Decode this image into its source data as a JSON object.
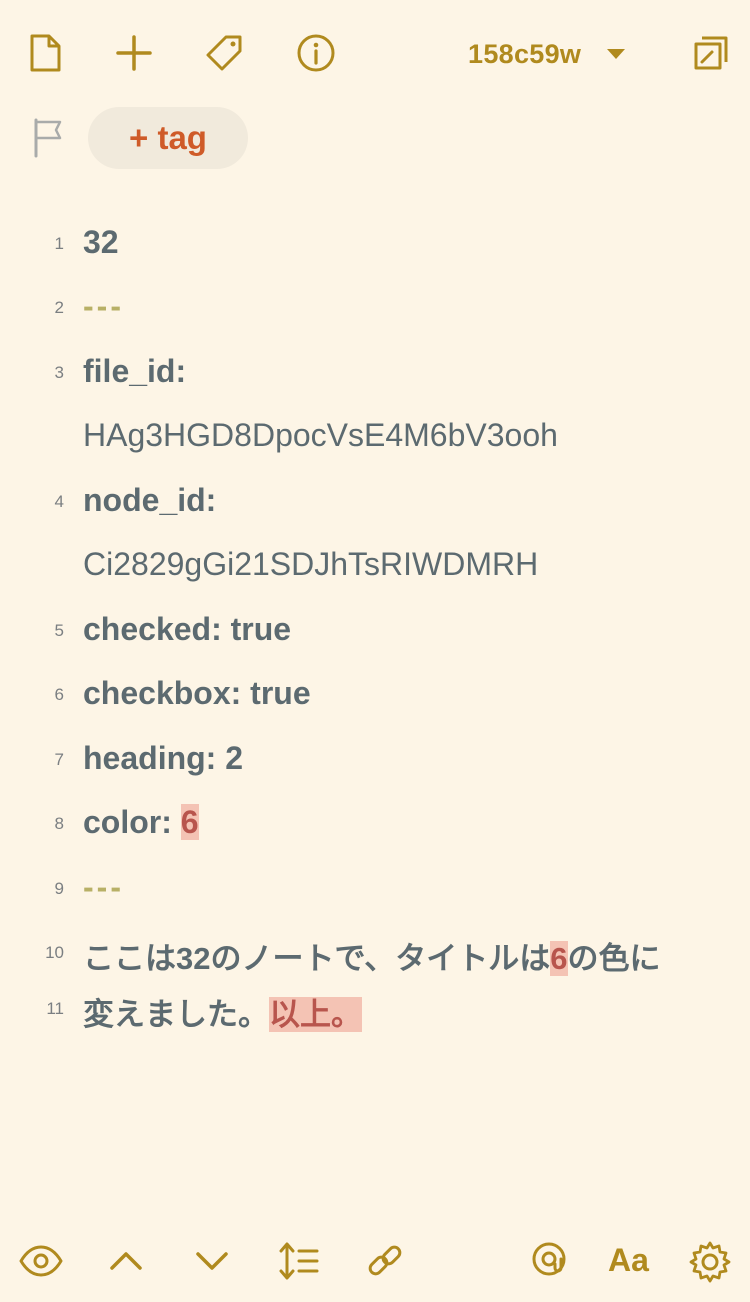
{
  "toolbar_top": {
    "icons": [
      "new-file-icon",
      "plus-icon",
      "tag-icon",
      "info-icon",
      "window-icon"
    ],
    "branch": "158c59w"
  },
  "tag_button": "+ tag",
  "lines": [
    {
      "num": "1",
      "text": "32"
    },
    {
      "num": "2",
      "text": "---"
    },
    {
      "num": "3",
      "text": "file_id:"
    },
    {
      "num": "",
      "text": "HAg3HGD8DpocVsE4M6bV3ooh"
    },
    {
      "num": "4",
      "text": "node_id:"
    },
    {
      "num": "",
      "text": "Ci2829gGi21SDJhTsRIWDMRH"
    },
    {
      "num": "5",
      "text": "checked: true"
    },
    {
      "num": "6",
      "text": "checkbox: true"
    },
    {
      "num": "7",
      "text": "heading: 2"
    },
    {
      "num": "8",
      "prefix": "color: ",
      "highlight": "6"
    },
    {
      "num": "9",
      "text": "---"
    },
    {
      "num": "10",
      "a": "ここは32のノートで、タイトルは",
      "hl": "6",
      "b": "の色に"
    },
    {
      "num": "11",
      "a": "変えました。",
      "hl": "以上。"
    }
  ],
  "toolbar_bottom": {
    "icons": [
      "eye-icon",
      "chevron-up-icon",
      "chevron-down-icon",
      "line-height-icon",
      "link-icon",
      "search-icon",
      "font-size-icon",
      "settings-icon"
    ],
    "font_label": "Aa"
  },
  "colors": {
    "accent": "#b08a1e",
    "background": "#fdf5e6",
    "tag_text": "#cf5b28",
    "highlight": "#f4c3b4"
  }
}
